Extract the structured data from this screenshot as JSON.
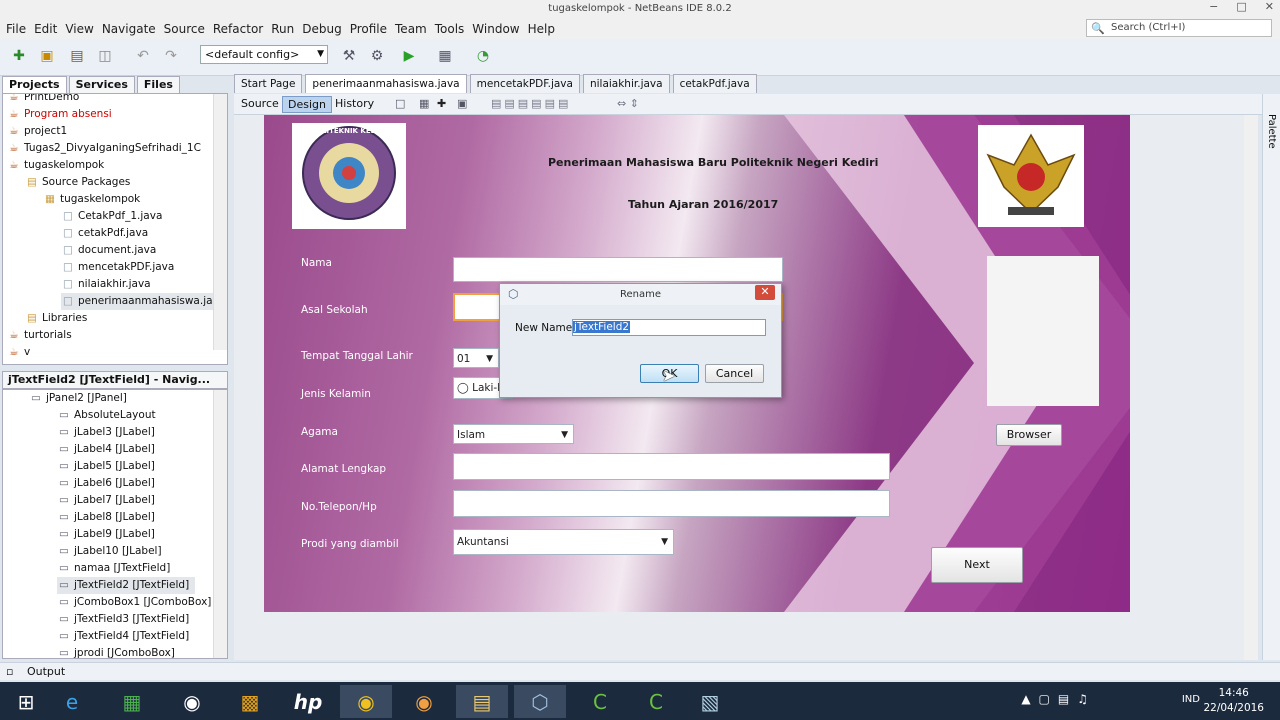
{
  "window": {
    "title": "tugaskelompok - NetBeans IDE 8.0.2",
    "controls": [
      "−",
      "□",
      "✕"
    ]
  },
  "menu": [
    "File",
    "Edit",
    "View",
    "Navigate",
    "Source",
    "Refactor",
    "Run",
    "Debug",
    "Profile",
    "Team",
    "Tools",
    "Window",
    "Help"
  ],
  "search": {
    "placeholder": "Search (Ctrl+I)"
  },
  "toolbar": {
    "config": "<default config>"
  },
  "left_tabs": [
    "Projects",
    "Services",
    "Files"
  ],
  "project_tree": [
    {
      "label": "PrintDemo",
      "indent": 0,
      "icon": "cup-icon"
    },
    {
      "label": "Program absensi",
      "indent": 0,
      "icon": "cup-icon",
      "color": "#cc0000"
    },
    {
      "label": "project1",
      "indent": 0,
      "icon": "cup-icon"
    },
    {
      "label": "Tugas2_DivyaIganingSefrihadi_1C",
      "indent": 0,
      "icon": "cup-icon"
    },
    {
      "label": "tugaskelompok",
      "indent": 0,
      "icon": "cup-icon"
    },
    {
      "label": "Source Packages",
      "indent": 1,
      "icon": "folder-icon"
    },
    {
      "label": "tugaskelompok",
      "indent": 2,
      "icon": "package-icon"
    },
    {
      "label": "CetakPdf_1.java",
      "indent": 3,
      "icon": "java-file-icon"
    },
    {
      "label": "cetakPdf.java",
      "indent": 3,
      "icon": "java-file-icon"
    },
    {
      "label": "document.java",
      "indent": 3,
      "icon": "java-file-icon"
    },
    {
      "label": "mencetakPDF.java",
      "indent": 3,
      "icon": "java-file-icon"
    },
    {
      "label": "nilaiakhir.java",
      "indent": 3,
      "icon": "java-file-icon"
    },
    {
      "label": "penerimaanmahasiswa.ja",
      "indent": 3,
      "icon": "java-file-icon",
      "selected": true
    },
    {
      "label": "Libraries",
      "indent": 1,
      "icon": "folder-icon"
    },
    {
      "label": "turtorials",
      "indent": 0,
      "icon": "cup-icon"
    },
    {
      "label": "v",
      "indent": 0,
      "icon": "cup-icon"
    }
  ],
  "navigator": {
    "title": "jTextField2 [JTextField] - Navig...",
    "items": [
      {
        "label": "jPanel2 [JPanel]",
        "indent": 0
      },
      {
        "label": "AbsoluteLayout",
        "indent": 1
      },
      {
        "label": "jLabel3 [JLabel]",
        "indent": 1
      },
      {
        "label": "jLabel4 [JLabel]",
        "indent": 1
      },
      {
        "label": "jLabel5 [JLabel]",
        "indent": 1
      },
      {
        "label": "jLabel6 [JLabel]",
        "indent": 1
      },
      {
        "label": "jLabel7 [JLabel]",
        "indent": 1
      },
      {
        "label": "jLabel8 [JLabel]",
        "indent": 1
      },
      {
        "label": "jLabel9 [JLabel]",
        "indent": 1
      },
      {
        "label": "jLabel10 [JLabel]",
        "indent": 1
      },
      {
        "label": "namaa [JTextField]",
        "indent": 1
      },
      {
        "label": "jTextField2 [JTextField]",
        "indent": 1,
        "selected": true
      },
      {
        "label": "jComboBox1 [JComboBox]",
        "indent": 1
      },
      {
        "label": "jTextField3 [JTextField]",
        "indent": 1
      },
      {
        "label": "jTextField4 [JTextField]",
        "indent": 1
      },
      {
        "label": "jprodi [JComboBox]",
        "indent": 1
      }
    ]
  },
  "editor_tabs": [
    {
      "label": "Start Page"
    },
    {
      "label": "penerimaanmahasiswa.java",
      "active": true
    },
    {
      "label": "mencetakPDF.java"
    },
    {
      "label": "nilaiakhir.java"
    },
    {
      "label": "cetakPdf.java"
    }
  ],
  "editor_modes": [
    "Source",
    "Design",
    "History"
  ],
  "form": {
    "logo_left": "POLITEKNIK KEDIRI",
    "title1": "Penerimaan Mahasiswa Baru Politeknik Negeri Kediri",
    "title2": "Tahun Ajaran 2016/2017",
    "labels": {
      "nama": "Nama",
      "asal": "Asal Sekolah",
      "ttl": "Tempat Tanggal Lahir",
      "jk": "Jenis Kelamin",
      "agama": "Agama",
      "alamat": "Alamat Lengkap",
      "telp": "No.Telepon/Hp",
      "prodi": "Prodi yang diambil"
    },
    "ttl_day": "01",
    "jk_option": "Laki-La",
    "agama_value": "Islam",
    "prodi_value": "Akuntansi",
    "browse_button": "Browser",
    "next_button": "Next"
  },
  "dialog": {
    "title": "Rename",
    "field_label": "New Name:",
    "field_value": "jTextField2",
    "ok": "OK",
    "cancel": "Cancel"
  },
  "palette_label": "Palette",
  "output_label": "Output",
  "taskbar": {
    "lang": "IND",
    "time": "14:46",
    "date": "22/04/2016"
  }
}
